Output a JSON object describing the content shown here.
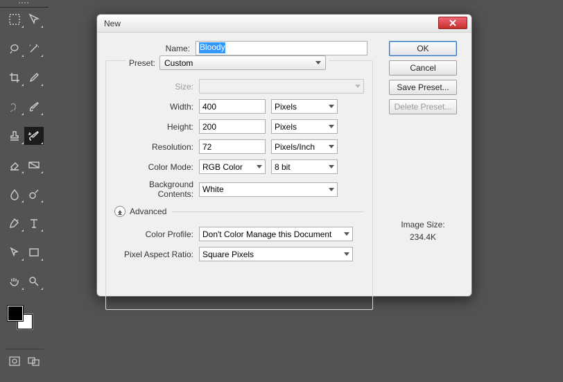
{
  "dialog": {
    "title": "New",
    "name_label": "Name:",
    "name_value": "Bloody",
    "preset_label": "Preset:",
    "preset_value": "Custom",
    "size_label": "Size:",
    "size_value": "",
    "width_label": "Width:",
    "width_value": "400",
    "width_unit": "Pixels",
    "height_label": "Height:",
    "height_value": "200",
    "height_unit": "Pixels",
    "resolution_label": "Resolution:",
    "resolution_value": "72",
    "resolution_unit": "Pixels/Inch",
    "colormode_label": "Color Mode:",
    "colormode_value": "RGB Color",
    "colordepth_value": "8 bit",
    "bgcontents_label": "Background Contents:",
    "bgcontents_value": "White",
    "advanced_label": "Advanced",
    "colorprofile_label": "Color Profile:",
    "colorprofile_value": "Don't Color Manage this Document",
    "par_label": "Pixel Aspect Ratio:",
    "par_value": "Square Pixels",
    "buttons": {
      "ok": "OK",
      "cancel": "Cancel",
      "save_preset": "Save Preset...",
      "delete_preset": "Delete Preset..."
    },
    "image_size_label": "Image Size:",
    "image_size_value": "234.4K"
  },
  "tools": [
    "marquee",
    "move",
    "lasso",
    "magic-wand",
    "crop",
    "eyedropper",
    "healing-brush",
    "brush",
    "stamp",
    "history-brush",
    "eraser",
    "gradient",
    "blur",
    "dodge",
    "pen",
    "type",
    "path-select",
    "shape",
    "hand",
    "zoom"
  ],
  "colors": {
    "foreground": "#000000",
    "background": "#ffffff"
  }
}
